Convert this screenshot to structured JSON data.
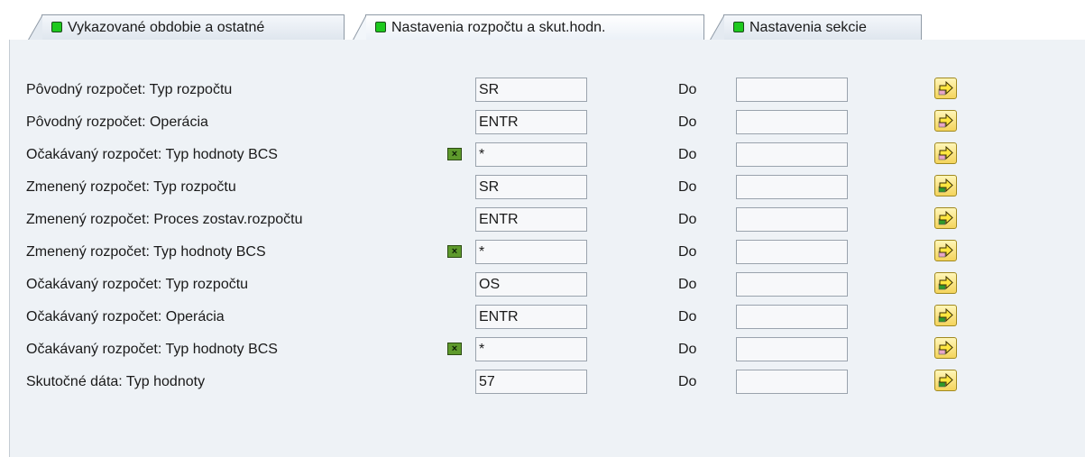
{
  "tabs": [
    {
      "label": "Vykazované obdobie a ostatné",
      "active": false
    },
    {
      "label": "Nastavenia rozpočtu a skut.hodn.",
      "active": true
    },
    {
      "label": "Nastavenia sekcie",
      "active": false
    }
  ],
  "colors": {
    "tab_indicator": "#1ec91e",
    "panel_bg": "#eef2f6",
    "arrow_button": "#f4d45c",
    "arrow_green": "#2f9a2a",
    "arrow_pink": "#e8a6c8",
    "multi_icon": "#5e9a2c"
  },
  "rows": [
    {
      "label": "Pôvodný rozpočet: Typ rozpočtu",
      "from": "SR",
      "to_label": "Do",
      "to": "",
      "multi": false,
      "arrow_variant": "pink"
    },
    {
      "label": "Pôvodný rozpočet: Operácia",
      "from": "ENTR",
      "to_label": "Do",
      "to": "",
      "multi": false,
      "arrow_variant": "pink"
    },
    {
      "label": "Očakávaný rozpočet: Typ hodnoty BCS",
      "from": "*",
      "to_label": "Do",
      "to": "",
      "multi": true,
      "arrow_variant": "pink"
    },
    {
      "label": "Zmenený rozpočet: Typ rozpočtu",
      "from": "SR",
      "to_label": "Do",
      "to": "",
      "multi": false,
      "arrow_variant": "green"
    },
    {
      "label": "Zmenený rozpočet: Proces zostav.rozpočtu",
      "from": "ENTR",
      "to_label": "Do",
      "to": "",
      "multi": false,
      "arrow_variant": "green"
    },
    {
      "label": "Zmenený rozpočet: Typ hodnoty BCS",
      "from": "*",
      "to_label": "Do",
      "to": "",
      "multi": true,
      "arrow_variant": "pink"
    },
    {
      "label": "Očakávaný rozpočet: Typ rozpočtu",
      "from": "OS",
      "to_label": "Do",
      "to": "",
      "multi": false,
      "arrow_variant": "green"
    },
    {
      "label": "Očakávaný rozpočet: Operácia",
      "from": "ENTR",
      "to_label": "Do",
      "to": "",
      "multi": false,
      "arrow_variant": "green"
    },
    {
      "label": "Očakávaný rozpočet: Typ hodnoty BCS",
      "from": "*",
      "to_label": "Do",
      "to": "",
      "multi": true,
      "arrow_variant": "pink"
    },
    {
      "label": "Skutočné dáta: Typ hodnoty",
      "from": "57",
      "to_label": "Do",
      "to": "",
      "multi": false,
      "arrow_variant": "green"
    }
  ],
  "icons": {
    "tab_status": "green-square-icon",
    "multi_select": "multiple-selection-icon",
    "arrow_button": "arrow-right-icon"
  }
}
